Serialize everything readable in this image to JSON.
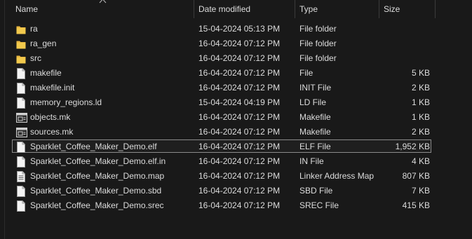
{
  "header": {
    "name": "Name",
    "date_modified": "Date modified",
    "type": "Type",
    "size": "Size"
  },
  "colors": {
    "background": "#191919",
    "text": "#dcdcdc",
    "folder": "#f2c94c",
    "selection_border": "#8a8a8a"
  },
  "files": [
    {
      "name": "ra",
      "date": "15-04-2024 05:13 PM",
      "type": "File folder",
      "size": "",
      "icon": "folder-icon"
    },
    {
      "name": "ra_gen",
      "date": "16-04-2024 07:12 PM",
      "type": "File folder",
      "size": "",
      "icon": "folder-icon"
    },
    {
      "name": "src",
      "date": "16-04-2024 07:12 PM",
      "type": "File folder",
      "size": "",
      "icon": "folder-icon"
    },
    {
      "name": "makefile",
      "date": "16-04-2024 07:12 PM",
      "type": "File",
      "size": "5 KB",
      "icon": "file-icon"
    },
    {
      "name": "makefile.init",
      "date": "16-04-2024 07:12 PM",
      "type": "INIT File",
      "size": "2 KB",
      "icon": "file-icon"
    },
    {
      "name": "memory_regions.ld",
      "date": "15-04-2024 04:19 PM",
      "type": "LD File",
      "size": "1 KB",
      "icon": "file-icon"
    },
    {
      "name": "objects.mk",
      "date": "16-04-2024 07:12 PM",
      "type": "Makefile",
      "size": "1 KB",
      "icon": "makefile-icon"
    },
    {
      "name": "sources.mk",
      "date": "16-04-2024 07:12 PM",
      "type": "Makefile",
      "size": "2 KB",
      "icon": "makefile-icon"
    },
    {
      "name": "Sparklet_Coffee_Maker_Demo.elf",
      "date": "16-04-2024 07:12 PM",
      "type": "ELF File",
      "size": "1,952 KB",
      "icon": "file-icon",
      "selected": true
    },
    {
      "name": "Sparklet_Coffee_Maker_Demo.elf.in",
      "date": "16-04-2024 07:12 PM",
      "type": "IN File",
      "size": "4 KB",
      "icon": "file-icon"
    },
    {
      "name": "Sparklet_Coffee_Maker_Demo.map",
      "date": "16-04-2024 07:12 PM",
      "type": "Linker Address Map",
      "size": "807 KB",
      "icon": "text-file-icon"
    },
    {
      "name": "Sparklet_Coffee_Maker_Demo.sbd",
      "date": "16-04-2024 07:12 PM",
      "type": "SBD File",
      "size": "7 KB",
      "icon": "file-icon"
    },
    {
      "name": "Sparklet_Coffee_Maker_Demo.srec",
      "date": "16-04-2024 07:12 PM",
      "type": "SREC File",
      "size": "415 KB",
      "icon": "file-icon"
    }
  ]
}
